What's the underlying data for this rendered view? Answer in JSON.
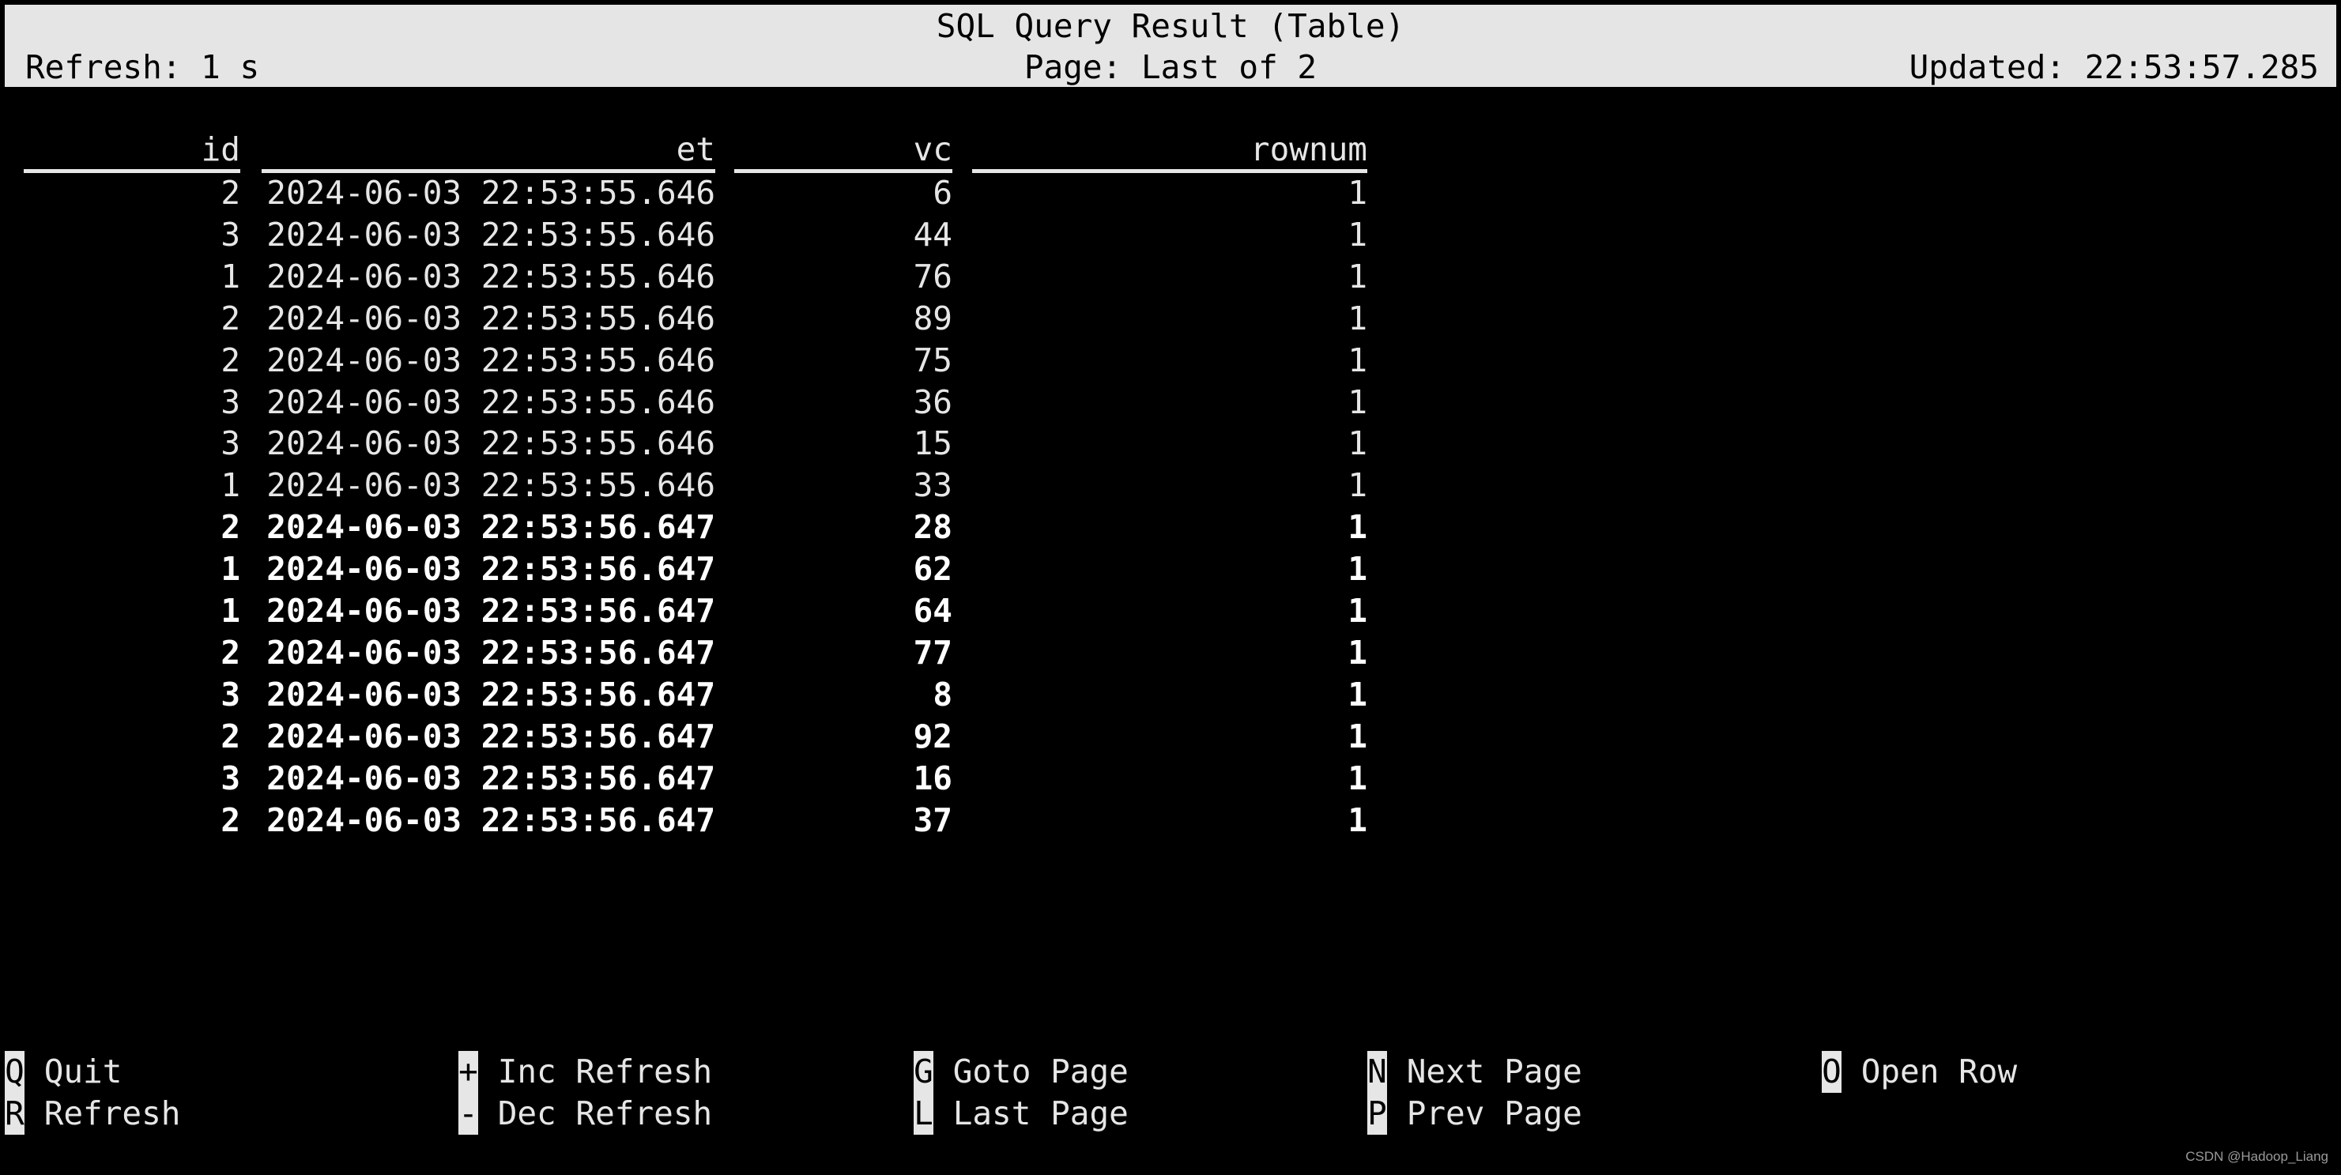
{
  "header": {
    "title": "SQL Query Result (Table)",
    "refresh": "Refresh: 1 s",
    "page": "Page: Last of 2",
    "updated": "Updated: 22:53:57.285"
  },
  "table": {
    "columns": [
      "id",
      "et",
      "vc",
      "rownum"
    ],
    "rows": [
      {
        "id": "2",
        "et": "2024-06-03 22:53:55.646",
        "vc": "6",
        "rownum": "1",
        "highlighted": false
      },
      {
        "id": "3",
        "et": "2024-06-03 22:53:55.646",
        "vc": "44",
        "rownum": "1",
        "highlighted": false
      },
      {
        "id": "1",
        "et": "2024-06-03 22:53:55.646",
        "vc": "76",
        "rownum": "1",
        "highlighted": false
      },
      {
        "id": "2",
        "et": "2024-06-03 22:53:55.646",
        "vc": "89",
        "rownum": "1",
        "highlighted": false
      },
      {
        "id": "2",
        "et": "2024-06-03 22:53:55.646",
        "vc": "75",
        "rownum": "1",
        "highlighted": false
      },
      {
        "id": "3",
        "et": "2024-06-03 22:53:55.646",
        "vc": "36",
        "rownum": "1",
        "highlighted": false
      },
      {
        "id": "3",
        "et": "2024-06-03 22:53:55.646",
        "vc": "15",
        "rownum": "1",
        "highlighted": false
      },
      {
        "id": "1",
        "et": "2024-06-03 22:53:55.646",
        "vc": "33",
        "rownum": "1",
        "highlighted": false
      },
      {
        "id": "2",
        "et": "2024-06-03 22:53:56.647",
        "vc": "28",
        "rownum": "1",
        "highlighted": true
      },
      {
        "id": "1",
        "et": "2024-06-03 22:53:56.647",
        "vc": "62",
        "rownum": "1",
        "highlighted": true
      },
      {
        "id": "1",
        "et": "2024-06-03 22:53:56.647",
        "vc": "64",
        "rownum": "1",
        "highlighted": true
      },
      {
        "id": "2",
        "et": "2024-06-03 22:53:56.647",
        "vc": "77",
        "rownum": "1",
        "highlighted": true
      },
      {
        "id": "3",
        "et": "2024-06-03 22:53:56.647",
        "vc": "8",
        "rownum": "1",
        "highlighted": true
      },
      {
        "id": "2",
        "et": "2024-06-03 22:53:56.647",
        "vc": "92",
        "rownum": "1",
        "highlighted": true
      },
      {
        "id": "3",
        "et": "2024-06-03 22:53:56.647",
        "vc": "16",
        "rownum": "1",
        "highlighted": true
      },
      {
        "id": "2",
        "et": "2024-06-03 22:53:56.647",
        "vc": "37",
        "rownum": "1",
        "highlighted": true
      }
    ]
  },
  "footer": {
    "keys": [
      {
        "key": "Q",
        "label": "Quit"
      },
      {
        "key": "R",
        "label": "Refresh"
      },
      {
        "key": "+",
        "label": "Inc Refresh"
      },
      {
        "key": "-",
        "label": "Dec Refresh"
      },
      {
        "key": "G",
        "label": "Goto Page"
      },
      {
        "key": "L",
        "label": "Last Page"
      },
      {
        "key": "N",
        "label": "Next Page"
      },
      {
        "key": "P",
        "label": "Prev Page"
      },
      {
        "key": "O",
        "label": "Open Row"
      }
    ]
  },
  "watermark": "CSDN @Hadoop_Liang"
}
